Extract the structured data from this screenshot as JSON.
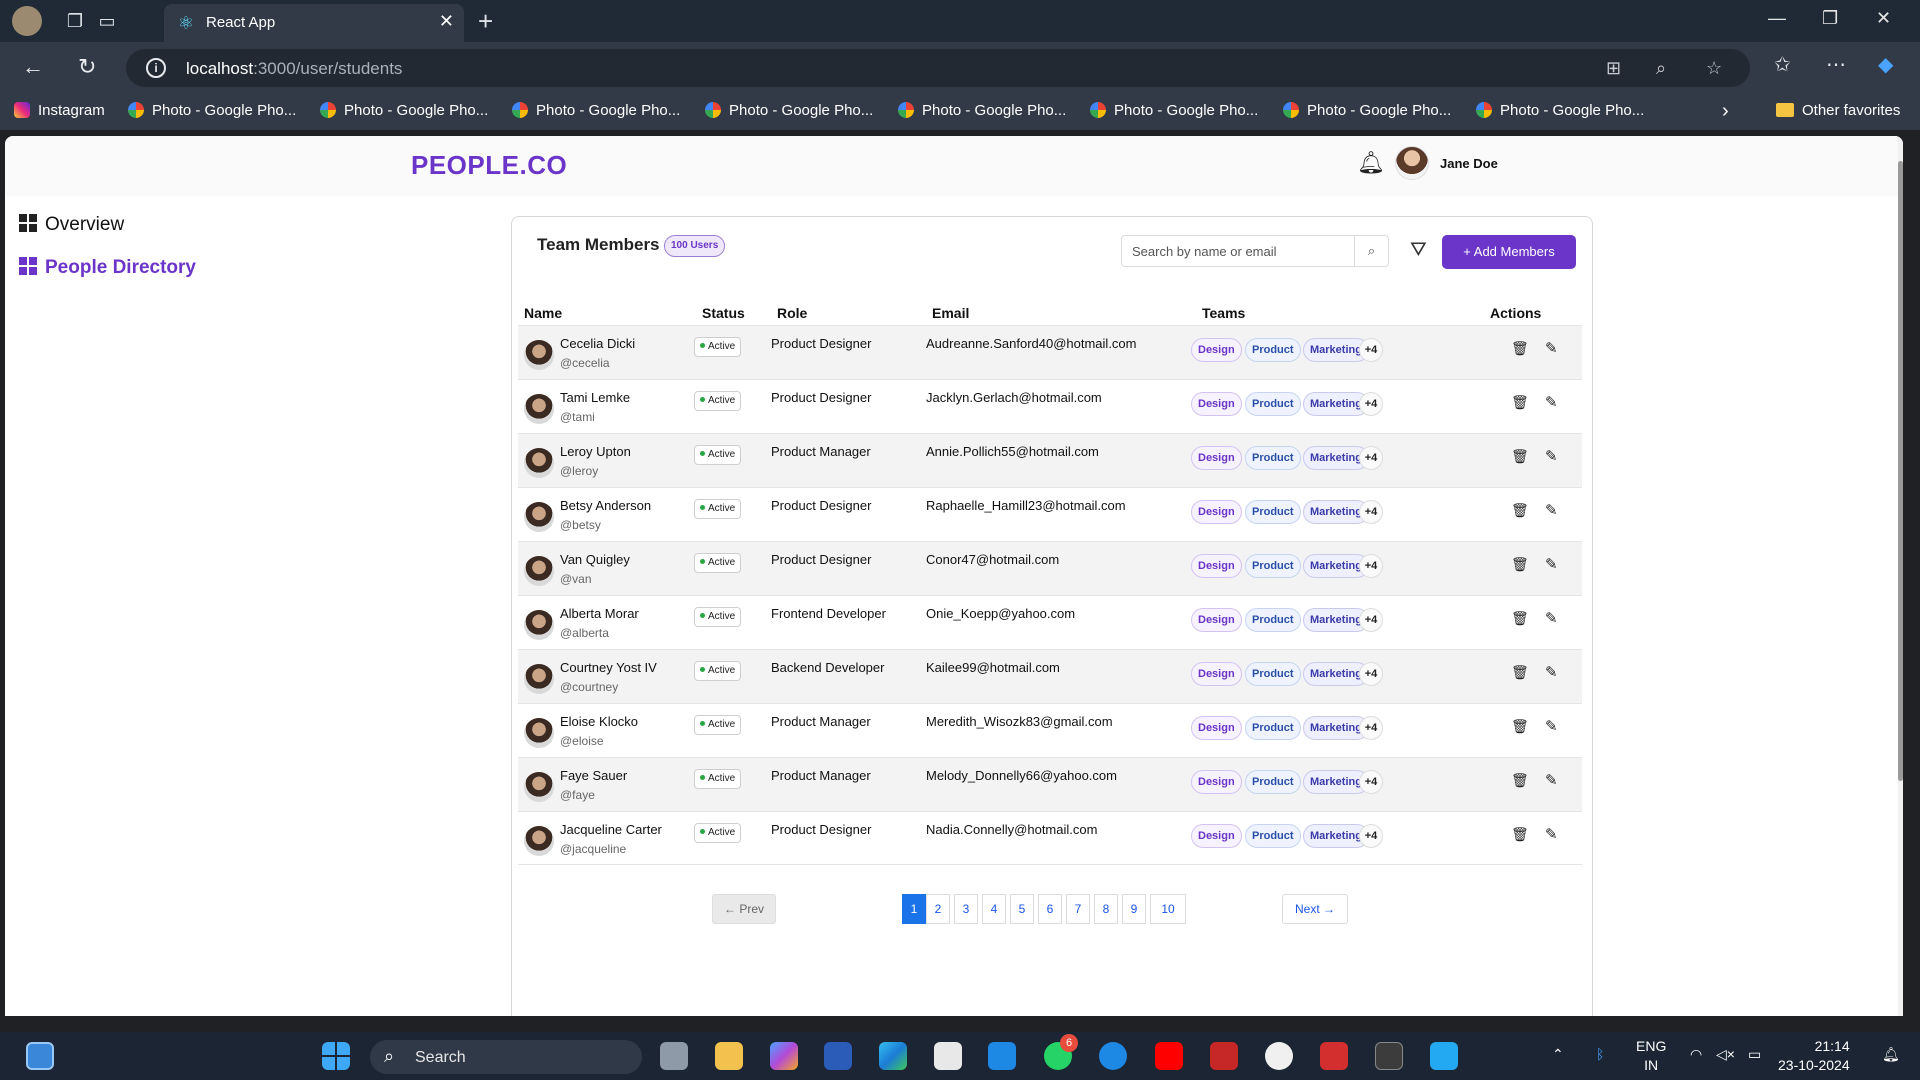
{
  "browser": {
    "tab_title": "React App",
    "url_host": "localhost",
    "url_path": ":3000/user/students",
    "bookmarks": [
      {
        "label": "Instagram",
        "icon": "instagram-icon"
      },
      {
        "label": "Photo - Google Pho...",
        "icon": "google-photos-icon"
      },
      {
        "label": "Photo - Google Pho...",
        "icon": "google-photos-icon"
      },
      {
        "label": "Photo - Google Pho...",
        "icon": "google-photos-icon"
      },
      {
        "label": "Photo - Google Pho...",
        "icon": "google-photos-icon"
      },
      {
        "label": "Photo - Google Pho...",
        "icon": "google-photos-icon"
      },
      {
        "label": "Photo - Google Pho...",
        "icon": "google-photos-icon"
      },
      {
        "label": "Photo - Google Pho...",
        "icon": "google-photos-icon"
      },
      {
        "label": "Photo - Google Pho...",
        "icon": "google-photos-icon"
      }
    ],
    "other_favorites": "Other favorites"
  },
  "app": {
    "logo": "PEOPLE.CO",
    "user_name": "Jane Doe",
    "accent_color": "#6a35c8"
  },
  "sidebar": {
    "items": [
      {
        "label": "Overview",
        "active": false
      },
      {
        "label": "People Directory",
        "active": true
      }
    ]
  },
  "team": {
    "title": "Team Members",
    "badge": "100 Users",
    "search_placeholder": "Search by name or email",
    "add_button": "+ Add Members",
    "columns": [
      "Name",
      "Status",
      "Role",
      "Email",
      "Teams",
      "Actions"
    ],
    "rows": [
      {
        "name": "Cecelia Dicki",
        "handle": "@cecelia",
        "status": "Active",
        "role": "Product Designer",
        "email": "Audreanne.Sanford40@hotmail.com",
        "teams": [
          "Design",
          "Product",
          "Marketing"
        ],
        "more": "+4"
      },
      {
        "name": "Tami Lemke",
        "handle": "@tami",
        "status": "Active",
        "role": "Product Designer",
        "email": "Jacklyn.Gerlach@hotmail.com",
        "teams": [
          "Design",
          "Product",
          "Marketing"
        ],
        "more": "+4"
      },
      {
        "name": "Leroy Upton",
        "handle": "@leroy",
        "status": "Active",
        "role": "Product Manager",
        "email": "Annie.Pollich55@hotmail.com",
        "teams": [
          "Design",
          "Product",
          "Marketing"
        ],
        "more": "+4"
      },
      {
        "name": "Betsy Anderson",
        "handle": "@betsy",
        "status": "Active",
        "role": "Product Designer",
        "email": "Raphaelle_Hamill23@hotmail.com",
        "teams": [
          "Design",
          "Product",
          "Marketing"
        ],
        "more": "+4"
      },
      {
        "name": "Van Quigley",
        "handle": "@van",
        "status": "Active",
        "role": "Product Designer",
        "email": "Conor47@hotmail.com",
        "teams": [
          "Design",
          "Product",
          "Marketing"
        ],
        "more": "+4"
      },
      {
        "name": "Alberta Morar",
        "handle": "@alberta",
        "status": "Active",
        "role": "Frontend Developer",
        "email": "Onie_Koepp@yahoo.com",
        "teams": [
          "Design",
          "Product",
          "Marketing"
        ],
        "more": "+4"
      },
      {
        "name": "Courtney Yost IV",
        "handle": "@courtney",
        "status": "Active",
        "role": "Backend Developer",
        "email": "Kailee99@hotmail.com",
        "teams": [
          "Design",
          "Product",
          "Marketing"
        ],
        "more": "+4"
      },
      {
        "name": "Eloise Klocko",
        "handle": "@eloise",
        "status": "Active",
        "role": "Product Manager",
        "email": "Meredith_Wisozk83@gmail.com",
        "teams": [
          "Design",
          "Product",
          "Marketing"
        ],
        "more": "+4"
      },
      {
        "name": "Faye Sauer",
        "handle": "@faye",
        "status": "Active",
        "role": "Product Manager",
        "email": "Melody_Donnelly66@yahoo.com",
        "teams": [
          "Design",
          "Product",
          "Marketing"
        ],
        "more": "+4"
      },
      {
        "name": "Jacqueline Carter",
        "handle": "@jacqueline",
        "status": "Active",
        "role": "Product Designer",
        "email": "Nadia.Connelly@hotmail.com",
        "teams": [
          "Design",
          "Product",
          "Marketing"
        ],
        "more": "+4"
      }
    ]
  },
  "pagination": {
    "prev": "Prev",
    "next": "Next",
    "pages": [
      "1",
      "2",
      "3",
      "4",
      "5",
      "6",
      "7",
      "8",
      "9",
      "10"
    ],
    "current": "1"
  },
  "taskbar": {
    "search_label": "Search",
    "whatsapp_badge": "6",
    "lang_top": "ENG",
    "lang_bottom": "IN",
    "time": "21:14",
    "date": "23-10-2024"
  }
}
